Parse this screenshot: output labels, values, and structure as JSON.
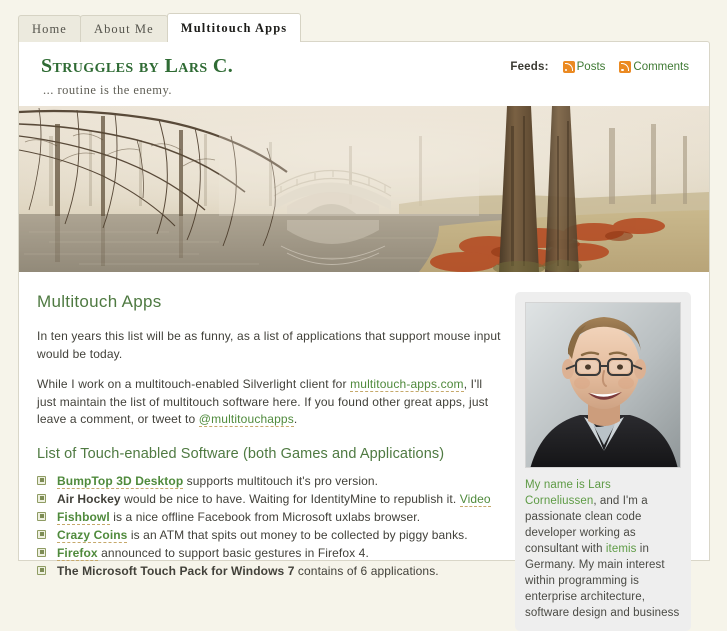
{
  "nav": {
    "tabs": [
      {
        "label": "Home",
        "active": false
      },
      {
        "label": "About Me",
        "active": false
      },
      {
        "label": "Multitouch Apps",
        "active": true
      }
    ]
  },
  "header": {
    "blog_title": "Struggles by Lars C.",
    "tagline": "... routine is the enemy.",
    "feeds_label": "Feeds:",
    "feeds": [
      {
        "label": "Posts",
        "icon": "rss-icon"
      },
      {
        "label": "Comments",
        "icon": "rss-icon"
      }
    ],
    "accent_green": "#2f6b34",
    "rss_orange": "#eb8a22"
  },
  "banner": {
    "alt": "Misty autumn park with a stone arch bridge over still water, bare trees and orange fallen leaves"
  },
  "main": {
    "post_title": "Multitouch Apps",
    "paragraph_1": "In ten years this list will be as funny, as a list of applications that support mouse input would be today.",
    "paragraph_2_part_1": "While I work on a multitouch-enabled Silverlight client for ",
    "paragraph_2_link_1": "multitouch-apps.com",
    "paragraph_2_part_2": ", I'll just maintain the list of multitouch software here. If you found other great apps, just leave a comment, or tweet to ",
    "paragraph_2_link_2": "@multitouchapps",
    "paragraph_2_part_3": ".",
    "list_title": "List of Touch-enabled Software (both Games and Applications)",
    "list_items": [
      {
        "name": "BumpTop 3D Desktop",
        "name_is_link": true,
        "text": " supports multitouch it's pro version.",
        "extra_link": ""
      },
      {
        "name": "Air Hockey",
        "name_is_link": false,
        "text": " would be nice to have. Waiting for IdentityMine to republish it. ",
        "extra_link": "Video"
      },
      {
        "name": "Fishbowl",
        "name_is_link": true,
        "text": " is a nice offline Facebook from Microsoft uxlabs browser.",
        "extra_link": ""
      },
      {
        "name": "Crazy Coins",
        "name_is_link": true,
        "text": " is an ATM that spits out money to be collected by piggy banks.",
        "extra_link": ""
      },
      {
        "name": "Firefox",
        "name_is_link": true,
        "text": " announced to support basic gestures in Firefox 4.",
        "extra_link": ""
      },
      {
        "name": "The Microsoft Touch Pack for Windows 7",
        "name_is_link": false,
        "text": " contains of 6 applications.",
        "extra_link": ""
      }
    ],
    "heading_green": "#4f7a42",
    "link_green": "#4f8a3c"
  },
  "sidebar": {
    "avatar_alt": "Photograph of Lars Corneliussen, smiling man with glasses in a dark jacket",
    "bio_link_1": "My name is Lars Corneliussen",
    "bio_part_1": ", and I'm a passionate clean code developer working as consultant with ",
    "bio_link_2": "itemis",
    "bio_part_2": " in Germany. My main interest within programming is enterprise",
    "bio_part_3": " architecture, software design and business"
  }
}
